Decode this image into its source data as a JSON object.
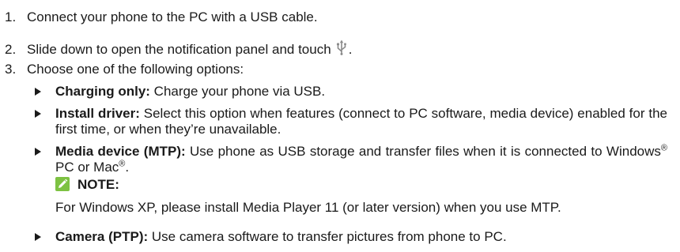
{
  "steps": [
    {
      "num": "1.",
      "text": "Connect your phone to the PC with a USB cable."
    },
    {
      "num": "2.",
      "text": "Slide down to open the notification panel and touch",
      "icon": "usb-icon",
      "trailing": "."
    },
    {
      "num": "3.",
      "text": "Choose one of the following options:"
    }
  ],
  "options": [
    {
      "head": "Charging only:",
      "body": " Charge your phone via USB."
    },
    {
      "head": "Install driver:",
      "body": " Select this option when features (connect to PC software, media device) enabled for the first time, or when they’re unavailable."
    },
    {
      "head": "Media device (MTP):",
      "body": " Use phone as USB storage and transfer files when it is connected to Windows",
      "reg1": "®",
      "mid": " PC or Mac",
      "reg2": "®",
      "end": "."
    },
    {
      "head": "Camera (PTP):",
      "body": " Use camera software to transfer pictures from phone to PC."
    }
  ],
  "note": {
    "heading": "NOTE:",
    "icon": "pencil-note-icon",
    "icon_color": "#7dc242",
    "body": "For Windows XP, please install Media Player 11 (or later version) when you use MTP."
  },
  "colors": {
    "text": "#1a1a1a",
    "usb_icon": "#8a8a8a",
    "note_icon": "#7dc242"
  }
}
